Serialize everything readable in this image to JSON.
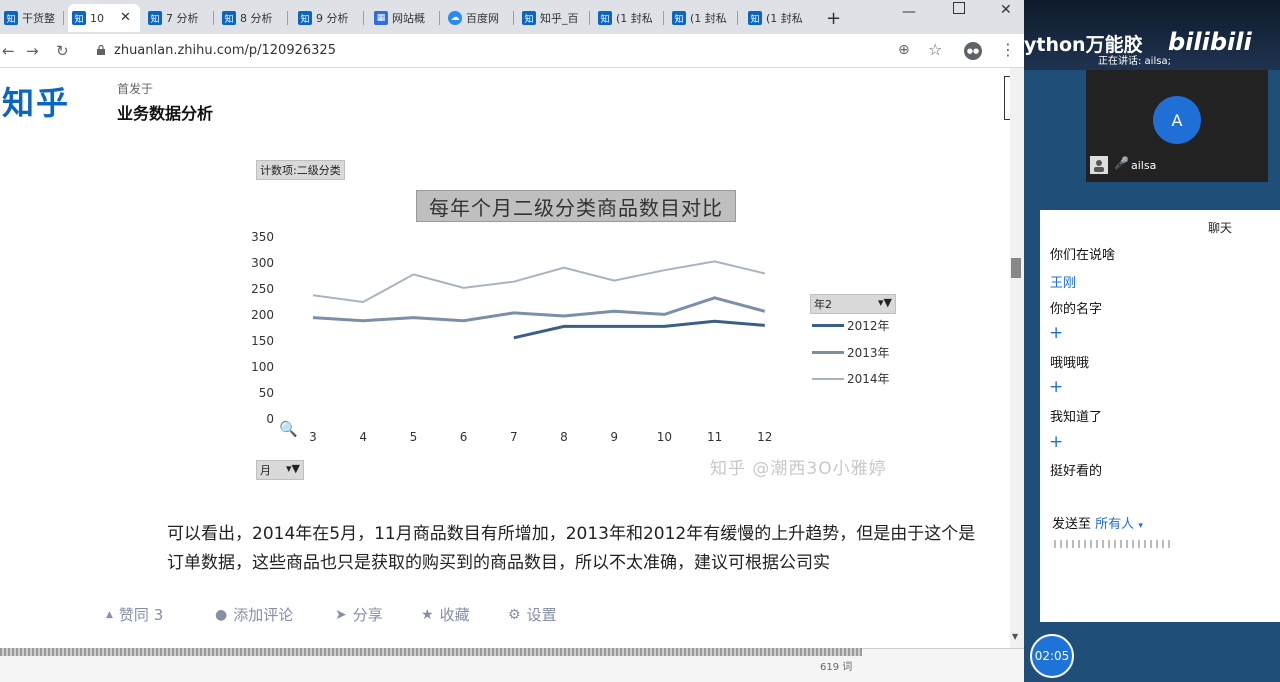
{
  "tabs": [
    {
      "label": "干货整",
      "icon": "zhihu-favicon"
    },
    {
      "label": "10",
      "icon": "zhihu-favicon",
      "active": true
    },
    {
      "label": "7 分析",
      "icon": "zhihu-favicon"
    },
    {
      "label": "8 分析",
      "icon": "zhihu-favicon"
    },
    {
      "label": "9 分析",
      "icon": "zhihu-favicon"
    },
    {
      "label": "网站概",
      "icon": "chart-favicon"
    },
    {
      "label": "百度网",
      "icon": "cloud-favicon"
    },
    {
      "label": "知乎_百",
      "icon": "zhihu-favicon"
    },
    {
      "label": "(1 封私",
      "icon": "zhihu-favicon"
    },
    {
      "label": "(1 封私",
      "icon": "zhihu-favicon"
    },
    {
      "label": "(1 封私",
      "icon": "zhihu-favicon"
    }
  ],
  "address": {
    "url": "zhuanlan.zhihu.com/p/120926325"
  },
  "header": {
    "logo": "知乎",
    "published_in": "首发于",
    "column": "业务数据分析"
  },
  "pivot": {
    "value_field": "计数项:二级分类",
    "year_field": "年2",
    "month_field": "月"
  },
  "chart_data": {
    "type": "line",
    "title": "每年个月二级分类商品数目对比",
    "categories": [
      3,
      4,
      5,
      6,
      7,
      8,
      9,
      10,
      11,
      12
    ],
    "yticks": [
      0,
      50,
      100,
      150,
      200,
      250,
      300,
      350
    ],
    "ylim": [
      0,
      350
    ],
    "series": [
      {
        "name": "2012年",
        "color": "#3a5f86",
        "values": [
          null,
          null,
          null,
          null,
          158,
          180,
          180,
          180,
          190,
          182
        ]
      },
      {
        "name": "2013年",
        "color": "#7b8fa8",
        "values": [
          197,
          191,
          197,
          191,
          206,
          200,
          209,
          203,
          235,
          209
        ]
      },
      {
        "name": "2014年",
        "color": "#a8b3c2",
        "values": [
          240,
          227,
          280,
          254,
          266,
          293,
          268,
          288,
          305,
          282
        ]
      }
    ],
    "legend": "right"
  },
  "watermark": "知乎 @潮西3O小雅婷",
  "article": {
    "paragraph": "可以看出，2014年在5月，11月商品数目有所增加，2013年和2012年有缓慢的上升趋势，但是由于这个是订单数据，这些商品也只是获取的购买到的商品数目，所以不太准确，建议可根据公司实"
  },
  "actions": {
    "upvote": "赞同 3",
    "comment": "添加评论",
    "share": "分享",
    "favorite": "收藏",
    "settings": "设置"
  },
  "footer": {
    "meta": "619 词"
  },
  "meeting": {
    "brand": "ython万能胶",
    "bili": "bilibili",
    "speaking": "正在讲话: ailsa;",
    "avatar_letter": "A",
    "participant": "ailsa"
  },
  "chat": {
    "title": "聊天",
    "messages": [
      "你们在说啥",
      "王刚",
      "你的名字",
      "哦哦哦",
      "我知道了",
      "挺好看的"
    ],
    "send_to_label": "发送至",
    "send_to_target": "所有人"
  },
  "timer": "02:05"
}
